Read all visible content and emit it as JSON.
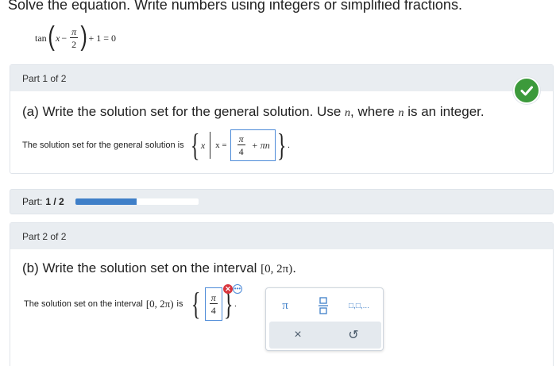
{
  "instruction": "Solve the equation. Write numbers using integers or simplified fractions.",
  "equation": {
    "func": "tan",
    "var": "x",
    "minus": "−",
    "pi": "π",
    "two": "2",
    "tail": "+ 1 = 0"
  },
  "part1": {
    "header": "Part 1 of 2",
    "question_pre": "(a) Write the solution set for the general solution. Use ",
    "question_var": "n",
    "question_mid": ", where ",
    "question_var2": "n",
    "question_post": " is an integer.",
    "answer_label": "The solution set for the general solution is",
    "set_var": "x",
    "set_eq": "x =",
    "answer_num": "π",
    "answer_den": "4",
    "answer_tail": "+ πn",
    "period": "."
  },
  "progress": {
    "label": "Part:",
    "value": "1 / 2",
    "fraction": 0.5
  },
  "part2": {
    "header": "Part 2 of 2",
    "question_pre": "(b) Write the solution set on the interval ",
    "interval": "[0, 2π)",
    "question_post": ".",
    "answer_label_pre": "The solution set on the interval",
    "answer_interval": "[0, 2π)",
    "answer_label_post": "is",
    "answer_num": "π",
    "answer_den": "4",
    "period": "."
  },
  "palette": {
    "pi": "π",
    "list": "□,□,...",
    "clear": "×",
    "undo": "↺"
  },
  "colors": {
    "accent": "#3f7fc8",
    "success": "#3c9a3b",
    "error": "#d9363e",
    "header_bg": "#e9edf1"
  }
}
